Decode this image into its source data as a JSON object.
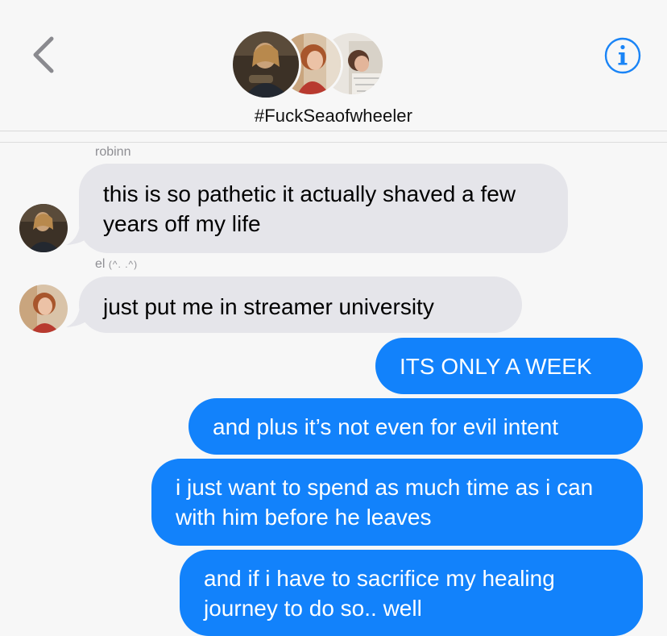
{
  "header": {
    "group_name": "#FuckSeaofwheeler",
    "back_icon": "chevron-left-icon",
    "info_icon": "info-circle-icon"
  },
  "messages": [
    {
      "direction": "incoming",
      "sender": "robinn",
      "text": "this is so pathetic it actually shaved a few years off my life"
    },
    {
      "direction": "incoming",
      "sender": "el",
      "sender_suffix": "(^. .^)",
      "text": "just put me in streamer university"
    },
    {
      "direction": "outgoing",
      "text": "ITS ONLY A WEEK"
    },
    {
      "direction": "outgoing",
      "text": "and plus it’s not even for evil intent"
    },
    {
      "direction": "outgoing",
      "text": "i just want to spend as much time as i can with him before he leaves"
    },
    {
      "direction": "outgoing",
      "text": "and if i have to sacrifice my healing journey to do so.. well"
    }
  ],
  "colors": {
    "outgoing_bubble": "#1282fb",
    "incoming_bubble": "#e5e5ea",
    "accent": "#1a84f6"
  }
}
